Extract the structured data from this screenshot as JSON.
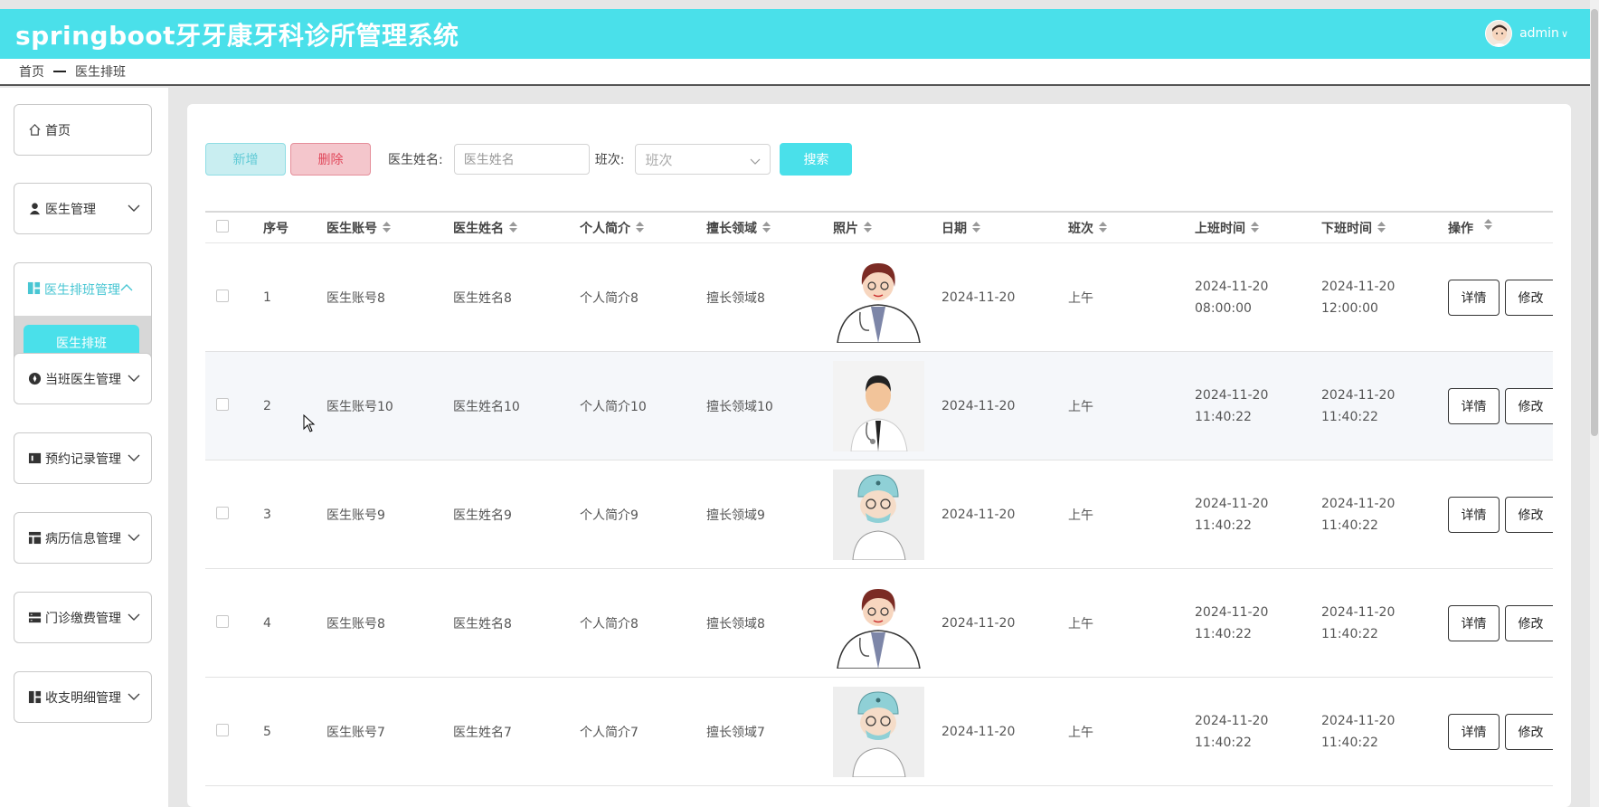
{
  "app": {
    "title": "springboot牙牙康牙科诊所管理系统",
    "username": "admin",
    "user_caret": "∨"
  },
  "breadcrumb": {
    "home": "首页",
    "current": "医生排班"
  },
  "sidebar": {
    "items": [
      {
        "label": "首页",
        "icon": "home-icon"
      },
      {
        "label": "医生管理",
        "icon": "user-icon"
      },
      {
        "label": "医生排班管理",
        "icon": "grid-icon",
        "expanded": true,
        "sub": [
          "医生排班"
        ]
      },
      {
        "label": "当班医生管理",
        "icon": "compass-icon"
      },
      {
        "label": "预约记录管理",
        "icon": "calendar-icon"
      },
      {
        "label": "病历信息管理",
        "icon": "table-icon"
      },
      {
        "label": "门诊缴费管理",
        "icon": "server-icon"
      },
      {
        "label": "收支明细管理",
        "icon": "grid-icon"
      }
    ]
  },
  "toolbar": {
    "add_label": "新增",
    "delete_label": "删除",
    "doctor_name_label": "医生姓名:",
    "doctor_name_placeholder": "医生姓名",
    "shift_label": "班次:",
    "shift_placeholder": "班次",
    "search_label": "搜索"
  },
  "table": {
    "columns": [
      "序号",
      "医生账号",
      "医生姓名",
      "个人简介",
      "擅长领域",
      "照片",
      "日期",
      "班次",
      "上班时间",
      "下班时间",
      "操作"
    ],
    "rows": [
      {
        "no": "1",
        "account": "医生账号8",
        "name": "医生姓名8",
        "intro": "个人简介8",
        "field": "擅长领域8",
        "photo": "doctor-female",
        "date": "2024-11-20",
        "shift": "上午",
        "on": "2024-11-20 08:00:00",
        "off": "2024-11-20 12:00:00"
      },
      {
        "no": "2",
        "account": "医生账号10",
        "name": "医生姓名10",
        "intro": "个人简介10",
        "field": "擅长领域10",
        "photo": "doctor-male",
        "date": "2024-11-20",
        "shift": "上午",
        "on": "2024-11-20 11:40:22",
        "off": "2024-11-20 11:40:22"
      },
      {
        "no": "3",
        "account": "医生账号9",
        "name": "医生姓名9",
        "intro": "个人简介9",
        "field": "擅长领域9",
        "photo": "doctor-surgeon",
        "date": "2024-11-20",
        "shift": "上午",
        "on": "2024-11-20 11:40:22",
        "off": "2024-11-20 11:40:22"
      },
      {
        "no": "4",
        "account": "医生账号8",
        "name": "医生姓名8",
        "intro": "个人简介8",
        "field": "擅长领域8",
        "photo": "doctor-female",
        "date": "2024-11-20",
        "shift": "上午",
        "on": "2024-11-20 11:40:22",
        "off": "2024-11-20 11:40:22"
      },
      {
        "no": "5",
        "account": "医生账号7",
        "name": "医生姓名7",
        "intro": "个人简介7",
        "field": "擅长领域7",
        "photo": "doctor-surgeon",
        "date": "2024-11-20",
        "shift": "上午",
        "on": "2024-11-20 11:40:22",
        "off": "2024-11-20 11:40:22"
      }
    ],
    "detail_label": "详情",
    "edit_label": "修改"
  },
  "colors": {
    "accent": "#4ae0ea",
    "danger": "#e1495c",
    "background": "#e6e6e6"
  }
}
